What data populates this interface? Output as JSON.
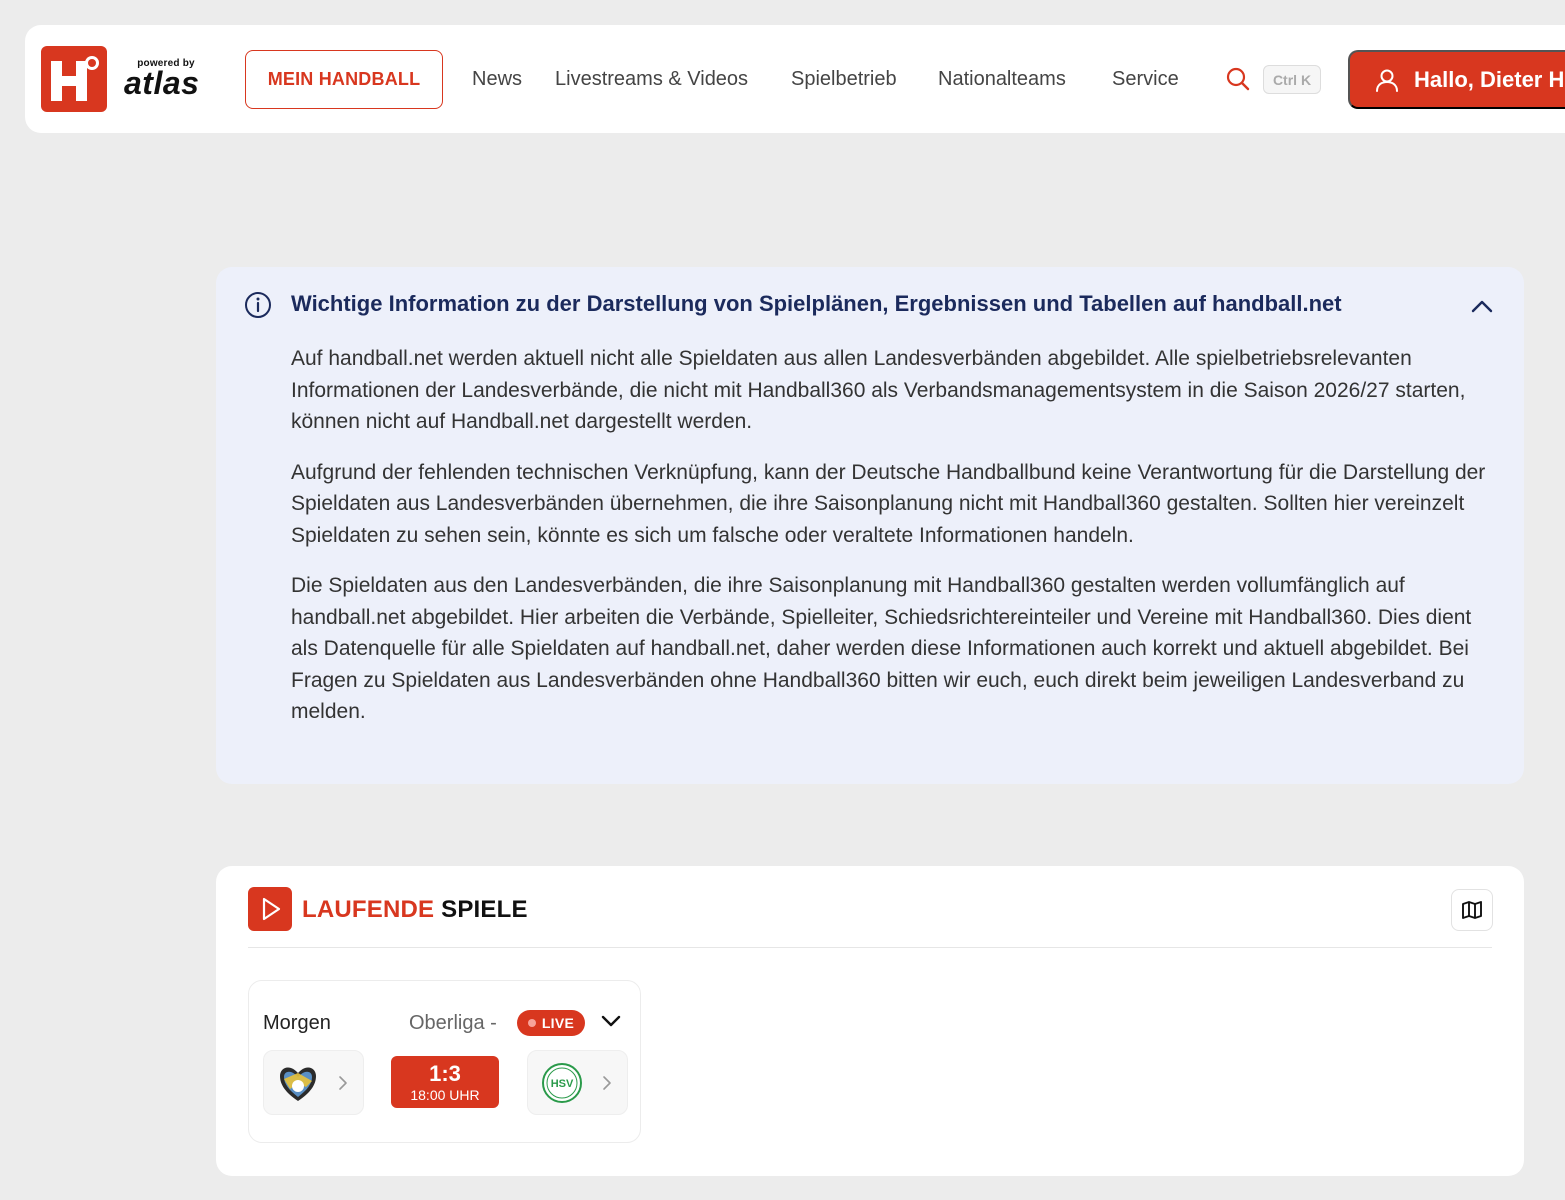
{
  "header": {
    "brand_small": "powered by",
    "brand_name": "atlas",
    "mein_handball_label": "MEIN HANDBALL",
    "nav": [
      {
        "label": "News"
      },
      {
        "label": "Livestreams & Videos"
      },
      {
        "label": "Spielbetrieb"
      },
      {
        "label": "Nationalteams"
      },
      {
        "label": "Service"
      }
    ],
    "search_shortcut": "Ctrl K",
    "user_greeting": "Hallo, Dieter Hu"
  },
  "info": {
    "title": "Wichtige Information zu der Darstellung von Spielplänen, Ergebnissen und Tabellen auf handball.net",
    "paragraphs": [
      "Auf handball.net werden aktuell nicht alle Spieldaten aus allen Landesverbänden abgebildet. Alle spielbetriebsrelevanten Informationen der Landesverbände, die nicht mit Handball360 als Verbandsmanagementsystem in die Saison 2026/27 starten, können nicht auf Handball.net dargestellt werden.",
      "Aufgrund der fehlenden technischen Verknüpfung, kann der Deutsche Handballbund keine Verantwortung für die Darstellung der Spieldaten aus Landesverbänden übernehmen, die ihre Saisonplanung nicht mit Handball360 gestalten. Sollten hier vereinzelt Spieldaten zu sehen sein, könnte es sich um falsche oder veraltete Informationen handeln.",
      "Die Spieldaten aus den Landesverbänden, die ihre Saisonplanung mit Handball360 gestalten werden vollumfänglich auf handball.net abgebildet. Hier arbeiten die Verbände, Spielleiter, Schiedsrichtereinteiler und Vereine mit Handball360. Dies dient als Datenquelle für alle Spieldaten auf handball.net, daher werden diese Informationen auch korrekt und aktuell abgebildet. Bei Fragen zu Spieldaten aus Landesverbänden ohne Handball360 bitten wir euch, euch direkt beim jeweiligen Landesverband zu melden."
    ]
  },
  "live_games": {
    "title_part1": "LAUFENDE",
    "title_part2": "SPIELE",
    "games": [
      {
        "day": "Morgen",
        "league": "Oberliga -",
        "live_label": "LIVE",
        "score": "1:3",
        "time": "18:00 UHR",
        "home_crest": "hsg-crest-icon",
        "away_crest": "hsv-crest-icon",
        "away_crest_text": "HSV"
      }
    ]
  },
  "colors": {
    "accent": "#d8371f",
    "info_background": "#edf0fa",
    "info_title": "#1b2a5c",
    "page_background": "#ececec"
  }
}
